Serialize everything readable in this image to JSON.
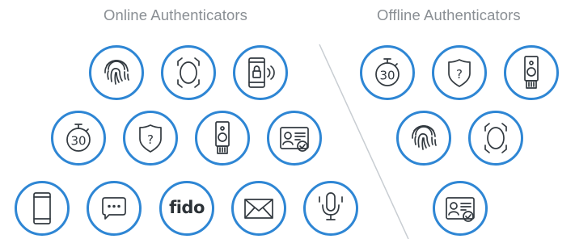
{
  "headings": {
    "online": "Online Authenticators",
    "offline": "Offline Authenticators"
  },
  "colors": {
    "circle_border": "#2e86d4",
    "icon_stroke": "#333a40",
    "heading_text": "#8a8f94",
    "divider": "#c8cdd2"
  },
  "online_authenticators": [
    {
      "icon": "fingerprint-icon"
    },
    {
      "icon": "face-recognition-icon"
    },
    {
      "icon": "phone-lock-signal-icon"
    },
    {
      "icon": "timer-30-icon",
      "label": "30"
    },
    {
      "icon": "shield-question-icon",
      "label": "?"
    },
    {
      "icon": "usb-security-key-icon"
    },
    {
      "icon": "id-card-verified-icon"
    },
    {
      "icon": "smartphone-icon"
    },
    {
      "icon": "chat-message-icon"
    },
    {
      "icon": "fido-logo-icon",
      "label": "fido"
    },
    {
      "icon": "email-icon"
    },
    {
      "icon": "voice-microphone-icon"
    }
  ],
  "offline_authenticators": [
    {
      "icon": "timer-30-icon",
      "label": "30"
    },
    {
      "icon": "shield-question-icon",
      "label": "?"
    },
    {
      "icon": "usb-security-key-icon"
    },
    {
      "icon": "fingerprint-icon"
    },
    {
      "icon": "face-recognition-icon"
    },
    {
      "icon": "id-card-verified-icon"
    }
  ]
}
